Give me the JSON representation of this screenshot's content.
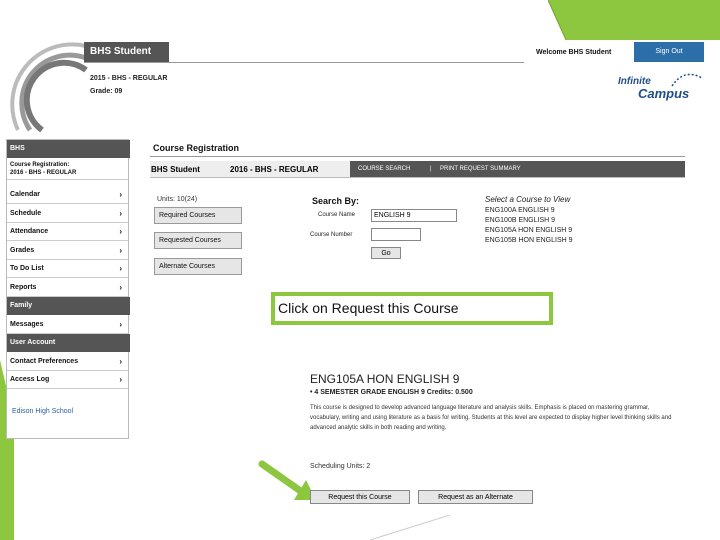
{
  "header": {
    "app_title": "BHS Student",
    "year_line": "2015 - BHS - REGULAR",
    "grade_line": "Grade: 09",
    "welcome": "Welcome BHS Student",
    "sign_out": "Sign Out",
    "logo_line1": "Infinite",
    "logo_line2": "Campus"
  },
  "sidebar": {
    "title": "BHS",
    "course_registration": "Course Registration:",
    "course_registration_sub": "2016 - BHS - REGULAR",
    "items": [
      {
        "label": "Calendar"
      },
      {
        "label": "Schedule"
      },
      {
        "label": "Attendance"
      },
      {
        "label": "Grades"
      },
      {
        "label": "To Do List"
      },
      {
        "label": "Reports"
      }
    ],
    "family_header": "Family",
    "messages": "Messages",
    "user_account_header": "User Account",
    "contact_preferences": "Contact Preferences",
    "access_log": "Access Log",
    "school_link": "Edison High School",
    "chevron": "›"
  },
  "main": {
    "title": "Course Registration",
    "student": "BHS Student",
    "year": "2016 - BHS - REGULAR",
    "tab_course_search": "COURSE SEARCH",
    "tab_separator": "|",
    "tab_print": "PRINT REQUEST SUMMARY",
    "units": "Units: 10(24)",
    "required_courses": "Required Courses",
    "requested_courses": "Requested Courses",
    "alternate_courses": "Alternate Courses",
    "search_by": "Search By:",
    "course_name_label": "Course Name",
    "course_name_value": "ENGLISH 9",
    "course_number_label": "Course Number",
    "course_number_value": "",
    "go_label": "Go",
    "select_course_title": "Select a Course to View",
    "courses": [
      "ENG100A ENGLISH 9",
      "ENG100B ENGLISH 9",
      "ENG105A HON ENGLISH 9",
      "ENG105B HON ENGLISH 9"
    ]
  },
  "callout": {
    "text": "Click on Request this Course"
  },
  "detail": {
    "course_title": "ENG105A HON ENGLISH 9",
    "subtitle": "• 4 SEMESTER GRADE ENGLISH 9 Credits: 0.500",
    "description": "This course is designed to develop advanced language literature and analysis skills. Emphasis is placed on mastering grammar, vocabulary, writing and using literature as a basis for writing. Students at this level are expected to display higher level thinking skills and advanced analytic skills in both reading and writing.",
    "scheduling_units": "Scheduling Units: 2",
    "request_button": "Request this Course",
    "alternate_button": "Request as an Alternate"
  },
  "colors": {
    "accent_green": "#8dc63f",
    "sidebar_header": "#555555",
    "sign_out_blue": "#2b6ea8"
  }
}
